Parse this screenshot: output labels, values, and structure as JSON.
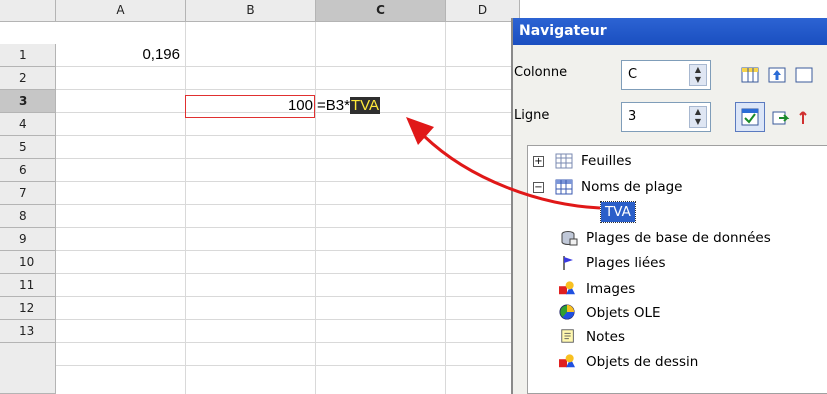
{
  "sheet": {
    "columns": [
      "A",
      "B",
      "C",
      "D"
    ],
    "selected_column": "C",
    "rows": [
      "1",
      "2",
      "3",
      "4",
      "5",
      "6",
      "7",
      "8",
      "9",
      "10",
      "11",
      "12",
      "13"
    ],
    "selected_row": "3",
    "cells": {
      "a1": "0,196",
      "b3": "100",
      "c3_formula_prefix": "=B3*",
      "c3_formula_name": "TVA"
    }
  },
  "navigator": {
    "title": "Navigateur",
    "column_label": "Colonne",
    "column_value": "C",
    "row_label": "Ligne",
    "row_value": "3",
    "tree": {
      "sheets": "Feuilles",
      "range_names": "Noms de plage",
      "selected_range": "TVA",
      "db_ranges": "Plages de base de données",
      "linked_ranges": "Plages liées",
      "images": "Images",
      "ole_objects": "Objets OLE",
      "notes": "Notes",
      "drawing_objects": "Objets de dessin"
    }
  },
  "colors": {
    "selection_border": "#e03030",
    "arrow": "#e01818",
    "title_bar": "#2c63d3",
    "highlight_bg": "#2f2f2f",
    "highlight_fg": "#ffeb3b"
  }
}
